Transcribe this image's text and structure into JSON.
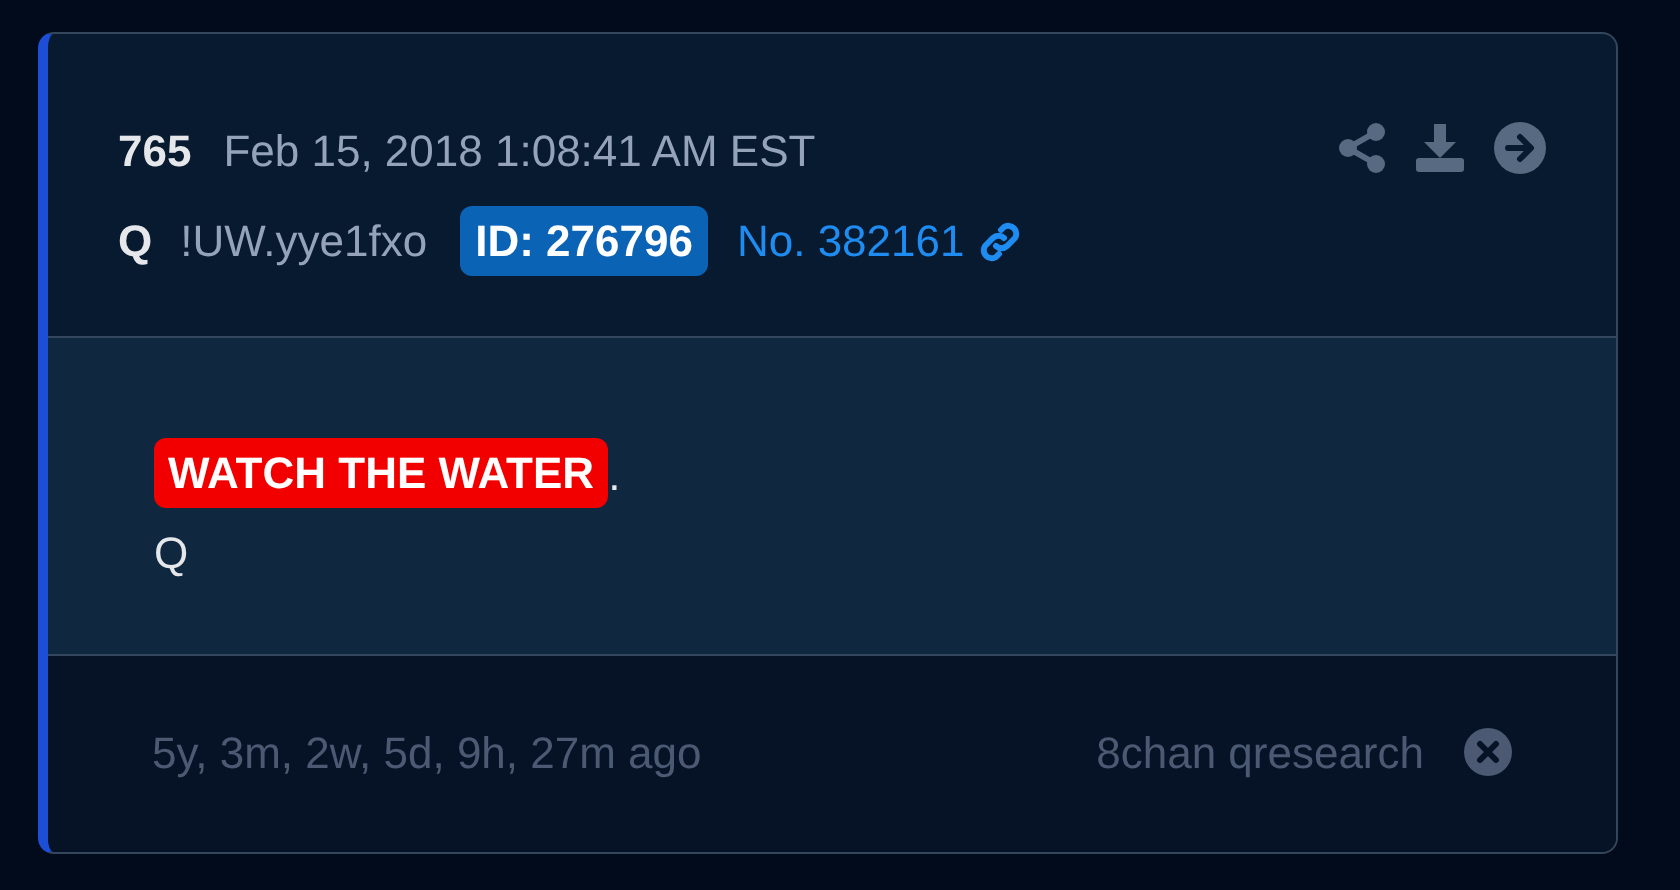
{
  "post": {
    "number": "765",
    "timestamp": "Feb 15, 2018 1:08:41 AM EST",
    "author": "Q",
    "tripcode": "!UW.yye1fxo",
    "id_badge": "ID: 276796",
    "post_link": "No. 382161",
    "actions": [
      {
        "kind": "share"
      },
      {
        "kind": "download"
      },
      {
        "kind": "next"
      }
    ],
    "body": [
      {
        "segments": [
          {
            "text": "WATCH THE WATER",
            "kind": "highlight"
          },
          {
            "text": ".",
            "kind": "plain"
          }
        ]
      },
      {
        "segments": [
          {
            "text": "Q",
            "kind": "plain"
          }
        ]
      }
    ],
    "footer": {
      "age": "5y, 3m, 2w, 5d, 9h, 27m ago",
      "source": "8chan qresearch"
    }
  }
}
